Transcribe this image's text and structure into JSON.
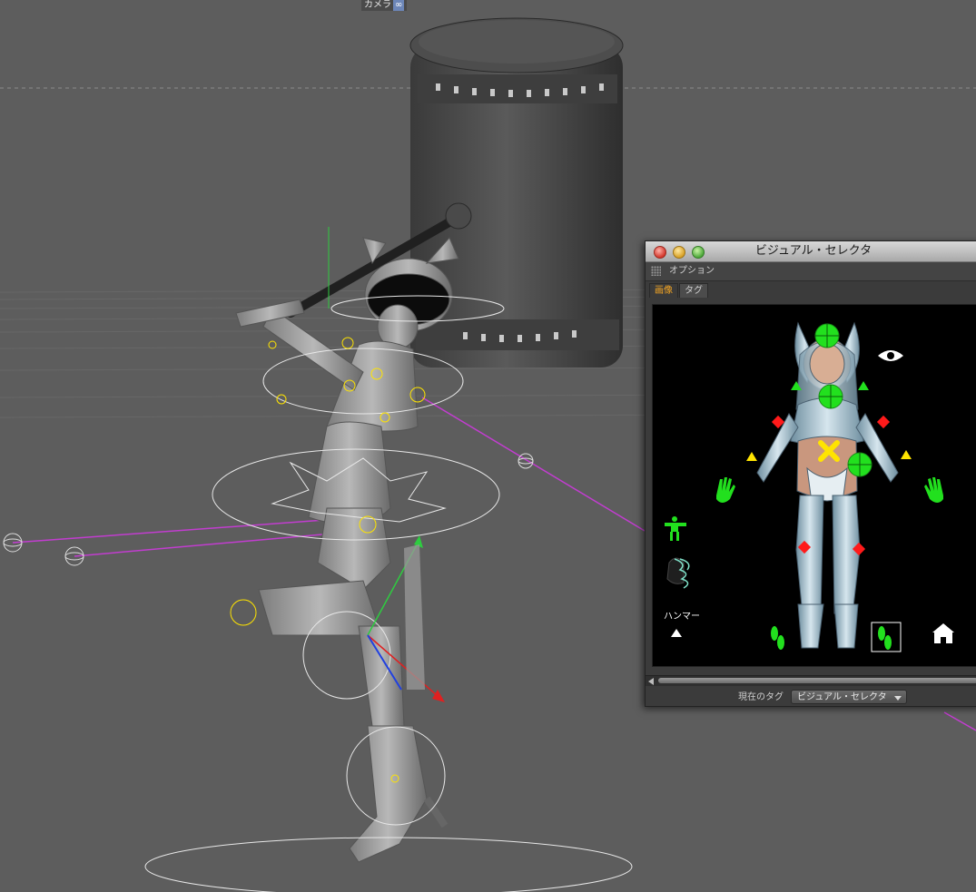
{
  "viewport": {
    "camera_label": "カメラ",
    "camera_icon": "infinity-icon",
    "camera_icon_glyph": "∞"
  },
  "visual_selector": {
    "title": "ビジュアル・セレクタ",
    "menu": {
      "options_label": "オプション"
    },
    "tabs": [
      {
        "label": "画像",
        "active": true
      },
      {
        "label": "タグ",
        "active": false
      }
    ],
    "panel": {
      "hammer_label": "ハンマー",
      "play_glyph": "▲",
      "icons": [
        "eye-icon",
        "home-icon",
        "body-icon",
        "hair-icon",
        "hand-left-icon",
        "hand-right-icon",
        "foot-left-icon",
        "foot-right-icon",
        "triangle-up-icon"
      ]
    },
    "footer": {
      "current_tag_label": "現在のタグ",
      "current_tag_value": "ビジュアル・セレクタ"
    },
    "colors": {
      "selector_green": "#22e01e",
      "selector_red": "#ff1a1a",
      "selector_yellow": "#ffe400",
      "tab_active": "#f5a623",
      "rig_magenta": "#c23dd0"
    }
  }
}
